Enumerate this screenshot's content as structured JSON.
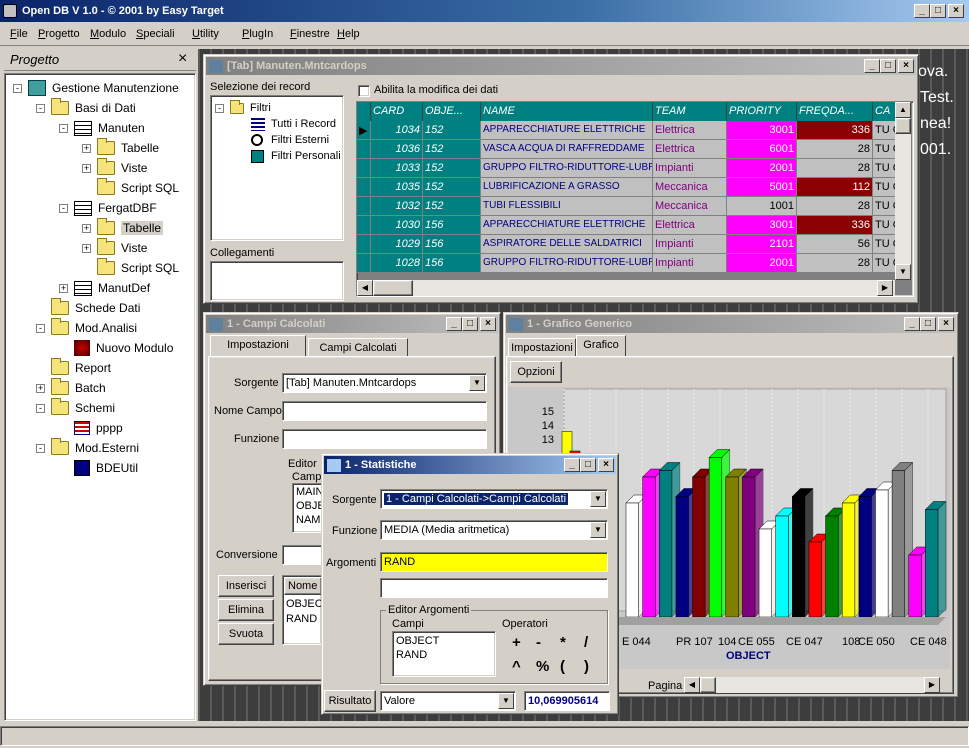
{
  "app": {
    "title": "Open DB V 1.0 - © 2001 by Easy Target"
  },
  "menu": [
    "File",
    "Progetto",
    "Modulo",
    "Speciali",
    "Utility",
    "PlugIn",
    "Finestre",
    "Help"
  ],
  "progetto": {
    "title": "Progetto",
    "tree": [
      {
        "label": "Gestione Manutenzione",
        "level": 0,
        "icon": "db-icon",
        "exp": "-"
      },
      {
        "label": "Basi di Dati",
        "level": 1,
        "icon": "folder-icon",
        "exp": "-"
      },
      {
        "label": "Manuten",
        "level": 2,
        "icon": "table-icon",
        "exp": "-"
      },
      {
        "label": "Tabelle",
        "level": 3,
        "icon": "folder-icon",
        "exp": "+"
      },
      {
        "label": "Viste",
        "level": 3,
        "icon": "folder-icon",
        "exp": "+"
      },
      {
        "label": "Script SQL",
        "level": 3,
        "icon": "folder-icon",
        "exp": ""
      },
      {
        "label": "FergatDBF",
        "level": 2,
        "icon": "table-icon",
        "exp": "-"
      },
      {
        "label": "Tabelle",
        "level": 3,
        "icon": "folder-icon",
        "exp": "+",
        "selected": true
      },
      {
        "label": "Viste",
        "level": 3,
        "icon": "folder-icon",
        "exp": "+"
      },
      {
        "label": "Script SQL",
        "level": 3,
        "icon": "folder-icon",
        "exp": ""
      },
      {
        "label": "ManutDef",
        "level": 2,
        "icon": "table-icon",
        "exp": "+"
      },
      {
        "label": "Schede Dati",
        "level": 1,
        "icon": "folder-icon",
        "exp": ""
      },
      {
        "label": "Mod.Analisi",
        "level": 1,
        "icon": "folder-icon",
        "exp": "-"
      },
      {
        "label": "Nuovo Modulo",
        "level": 2,
        "icon": "module-icon",
        "exp": ""
      },
      {
        "label": "Report",
        "level": 1,
        "icon": "folder-icon",
        "exp": ""
      },
      {
        "label": "Batch",
        "level": 1,
        "icon": "folder-icon",
        "exp": "+"
      },
      {
        "label": "Schemi",
        "level": 1,
        "icon": "folder-icon",
        "exp": "-"
      },
      {
        "label": "pppp",
        "level": 2,
        "icon": "schema-icon",
        "exp": ""
      },
      {
        "label": "Mod.Esterni",
        "level": 1,
        "icon": "folder-icon",
        "exp": "-"
      },
      {
        "label": "BDEUtil",
        "level": 2,
        "icon": "plugin-icon",
        "exp": ""
      }
    ]
  },
  "bg_text": [
    "ova.",
    "Test.",
    "nea!",
    "001."
  ],
  "tab_window": {
    "title": "[Tab] Manuten.Mntcardops",
    "selezione_label": "Selezione dei record",
    "filters_root": "Filtri",
    "filters": [
      "Tutti i Record",
      "Filtri Esterni",
      "Filtri Personali"
    ],
    "collegamenti_label": "Collegamenti",
    "abilita_label": "Abilita la modifica dei dati",
    "columns": [
      "CARD",
      "OBJE...",
      "NAME",
      "TEAM",
      "PRIORITY",
      "FREQDA...",
      "CA"
    ],
    "rows": [
      {
        "card": "1034",
        "obj": "152",
        "name": "APPARECCHIATURE ELETTRICHE",
        "team": "Elettrica",
        "prio": "3001",
        "freq": "336",
        "ca": "TU G",
        "prio_color": "#ff00ff",
        "freq_color": "#8b0000"
      },
      {
        "card": "1036",
        "obj": "152",
        "name": "VASCA ACQUA DI RAFFREDDAME",
        "team": "Elettrica",
        "prio": "6001",
        "freq": "28",
        "ca": "TU G",
        "prio_color": "#ff00ff",
        "freq_color": ""
      },
      {
        "card": "1033",
        "obj": "152",
        "name": "GRUPPO FILTRO-RIDUTTORE-LUBR",
        "team": "Impianti",
        "prio": "2001",
        "freq": "28",
        "ca": "TU G",
        "prio_color": "#ff00ff",
        "freq_color": ""
      },
      {
        "card": "1035",
        "obj": "152",
        "name": "LUBRIFICAZIONE A GRASSO",
        "team": "Meccanica",
        "prio": "5001",
        "freq": "112",
        "ca": "TU G",
        "prio_color": "#ff00ff",
        "freq_color": "#8b0000"
      },
      {
        "card": "1032",
        "obj": "152",
        "name": "TUBI FLESSIBILI",
        "team": "Meccanica",
        "prio": "1001",
        "freq": "28",
        "ca": "TU G",
        "prio_color": "",
        "freq_color": ""
      },
      {
        "card": "1030",
        "obj": "156",
        "name": "APPARECCHIATURE ELETTRICHE",
        "team": "Elettrica",
        "prio": "3001",
        "freq": "336",
        "ca": "TU G",
        "prio_color": "#ff00ff",
        "freq_color": "#8b0000"
      },
      {
        "card": "1029",
        "obj": "156",
        "name": "ASPIRATORE DELLE SALDATRICI",
        "team": "Impianti",
        "prio": "2101",
        "freq": "56",
        "ca": "TU G",
        "prio_color": "#ff00ff",
        "freq_color": ""
      },
      {
        "card": "1028",
        "obj": "156",
        "name": "GRUPPO FILTRO-RIDUTTORE-LUBR",
        "team": "Impianti",
        "prio": "2001",
        "freq": "28",
        "ca": "TU G",
        "prio_color": "#ff00ff",
        "freq_color": ""
      }
    ]
  },
  "campi_window": {
    "title": "1 - Campi Calcolati",
    "tabs": [
      "Impostazioni",
      "Campi Calcolati"
    ],
    "sorgente_label": "Sorgente",
    "sorgente_value": "[Tab] Manuten.Mntcardops",
    "nome_label": "Nome Campo",
    "funzione_label": "Funzione",
    "editor_label": "Editor",
    "campi_label": "Camp",
    "campi_items": [
      "MAIN",
      "OBJE",
      "NAM"
    ],
    "conversione_label": "Conversione",
    "buttons": [
      "Inserisci",
      "Elimina",
      "Svuota"
    ],
    "nome_col": "Nome",
    "list_items": [
      "OBJEC",
      "RAND"
    ]
  },
  "grafico_window": {
    "title": "1 - Grafico Generico",
    "tabs": [
      "Impostazioni",
      "Grafico"
    ],
    "opzioni_label": "Opzioni",
    "pagina_label": "Pagina"
  },
  "chart_data": {
    "type": "bar",
    "title": "",
    "xlabel": "OBJECT",
    "ylabel": "",
    "yticks": [
      "15",
      "14",
      "13"
    ],
    "x_tick_labels": [
      "E 044",
      "PR 107",
      "104",
      "CE 055",
      "CE 047",
      "108",
      "CE 050",
      "CE 048"
    ],
    "series": [
      {
        "color": "#ffffff",
        "values": [
          9.0
        ]
      },
      {
        "color": "#ff00ff",
        "values": [
          11.0
        ]
      },
      {
        "color": "#008080",
        "values": [
          11.5
        ]
      },
      {
        "color": "#000080",
        "values": [
          9.5
        ]
      },
      {
        "color": "#800000",
        "values": [
          11.0
        ]
      },
      {
        "color": "#00ff00",
        "values": [
          12.5
        ]
      },
      {
        "color": "#808000",
        "values": [
          11.0
        ]
      },
      {
        "color": "#800080",
        "values": [
          11.0
        ]
      },
      {
        "color": "#ffffff",
        "values": [
          7.0
        ]
      },
      {
        "color": "#00ffff",
        "values": [
          8.0
        ]
      },
      {
        "color": "#000000",
        "values": [
          9.5
        ]
      },
      {
        "color": "#ff0000",
        "values": [
          6.0
        ]
      },
      {
        "color": "#008000",
        "values": [
          8.0
        ]
      },
      {
        "color": "#ffff00",
        "values": [
          9.0
        ]
      },
      {
        "color": "#000080",
        "values": [
          9.5
        ]
      },
      {
        "color": "#ffffff",
        "values": [
          10.0
        ]
      },
      {
        "color": "#808080",
        "values": [
          11.5
        ]
      },
      {
        "color": "#ff00ff",
        "values": [
          5.0
        ]
      },
      {
        "color": "#008080",
        "values": [
          8.5
        ]
      }
    ],
    "partial_bars": [
      {
        "color": "#ffff00",
        "values": [
          14.5
        ]
      },
      {
        "color": "#ff0000",
        "values": [
          13.0
        ]
      }
    ]
  },
  "stat_window": {
    "title": "1 - Statistiche",
    "sorgente_label": "Sorgente",
    "sorgente_value": "1 - Campi Calcolati->Campi Calcolati",
    "funzione_label": "Funzione",
    "funzione_value": "MEDIA (Media aritmetica)",
    "argomenti_label": "Argomenti",
    "argomenti_value": "RAND",
    "editor_label": "Editor Argomenti",
    "campi_label": "Campi",
    "campi_items": [
      "OBJECT",
      "RAND"
    ],
    "operatori_label": "Operatori",
    "operatori": [
      "+",
      "-",
      "*",
      "/",
      "^",
      "%",
      "(",
      ")"
    ],
    "risultato_label": "Risultato",
    "risultato_combo": "Valore",
    "risultato_value": "10,069905614"
  }
}
